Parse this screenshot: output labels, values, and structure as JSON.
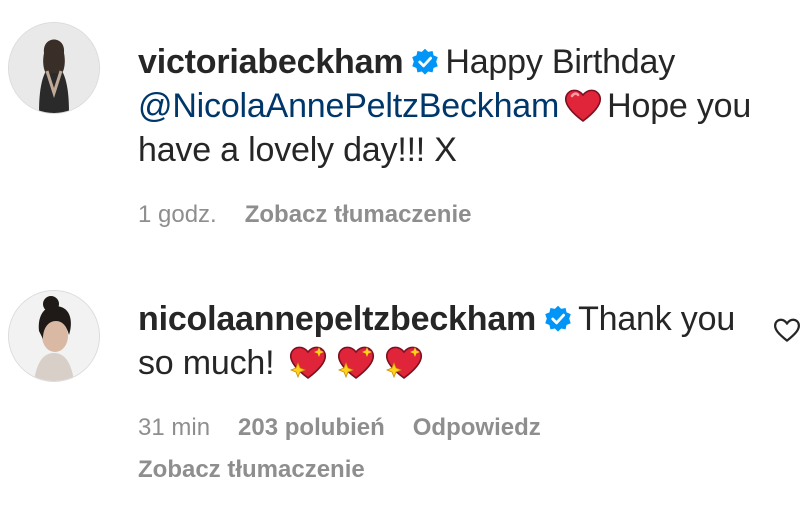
{
  "comments": [
    {
      "username": "victoriabeckham",
      "verified_icon": "verified-badge-icon",
      "text_pre": "Happy Birthday",
      "mention": "@NicolaAnnePeltzBeckham",
      "text_post": "Hope you have a lovely day!!! X",
      "emoji": "red-heart",
      "time": "1 godz.",
      "translate": "Zobacz tłumaczenie"
    },
    {
      "username": "nicolaannepeltzbeckham",
      "verified_icon": "verified-badge-icon",
      "text": "Thank you so much!",
      "emoji": "sparkling-heart",
      "time": "31 min",
      "likes": "203 polubień",
      "reply": "Odpowiedz",
      "translate": "Zobacz tłumaczenie",
      "like_icon": "heart-outline-icon"
    }
  ],
  "colors": {
    "text": "#262626",
    "secondary": "#8e8e8e",
    "mention": "#00376b",
    "verified": "#0095f6",
    "heart": "#ed4956"
  }
}
